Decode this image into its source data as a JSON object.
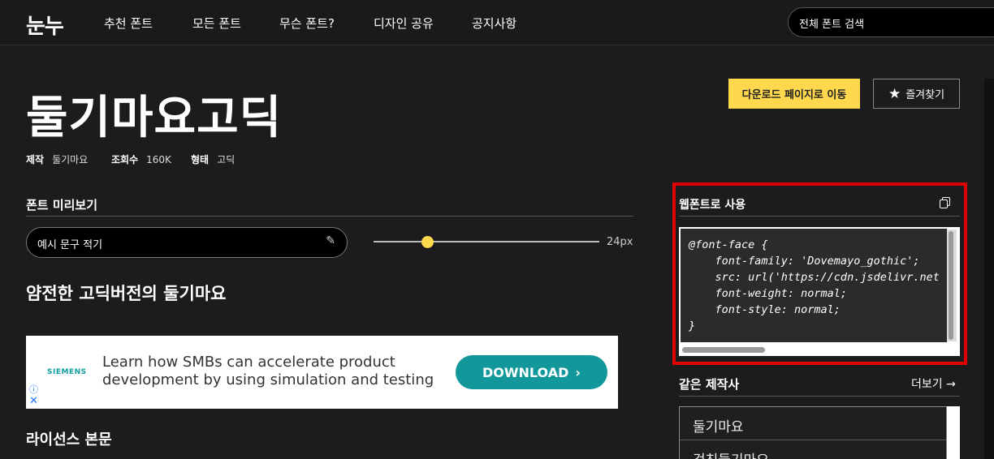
{
  "nav": {
    "logo": "눈누",
    "items": [
      "추천 폰트",
      "모든 폰트",
      "무슨 폰트?",
      "디자인 공유",
      "공지사항"
    ],
    "search_placeholder": "전체 폰트 검색"
  },
  "font": {
    "title": "둘기마요고딕",
    "meta": [
      {
        "label": "제작",
        "value": "둘기마요"
      },
      {
        "label": "조회수",
        "value": "160K"
      },
      {
        "label": "형태",
        "value": "고딕"
      }
    ],
    "download_label": "다운로드 페이지로 이동",
    "favorite_label": "즐겨찾기"
  },
  "preview": {
    "section_title": "폰트 미리보기",
    "input_placeholder": "예시 문구 적기",
    "size_value": "24px",
    "size_fraction": 0.24,
    "sample_text": "얌전한 고딕버전의 둘기마요"
  },
  "ad": {
    "brand": "SIEMENS",
    "text": "Learn how SMBs can accelerate product development by using simulation and testing",
    "button_label": "DOWNLOAD",
    "button_chevron": "›",
    "info_glyph": "ⓘ",
    "close_glyph": "✕"
  },
  "license": {
    "title": "라이선스 본문"
  },
  "webfont": {
    "title": "웹폰트로 사용",
    "code": "@font-face {\n    font-family: 'Dovemayo_gothic';\n    src: url('https://cdn.jsdelivr.net\n    font-weight: normal;\n    font-style: normal;\n}"
  },
  "same_maker": {
    "title": "같은 제작사",
    "more_label": "더보기 →",
    "items": [
      "둘기마요",
      "걷친둘기마요"
    ]
  },
  "icons": {
    "star": "★",
    "pencil": "✎"
  },
  "colors": {
    "accent": "#ffd84d",
    "highlight_border": "#e00000",
    "ad_button": "#12989a"
  }
}
